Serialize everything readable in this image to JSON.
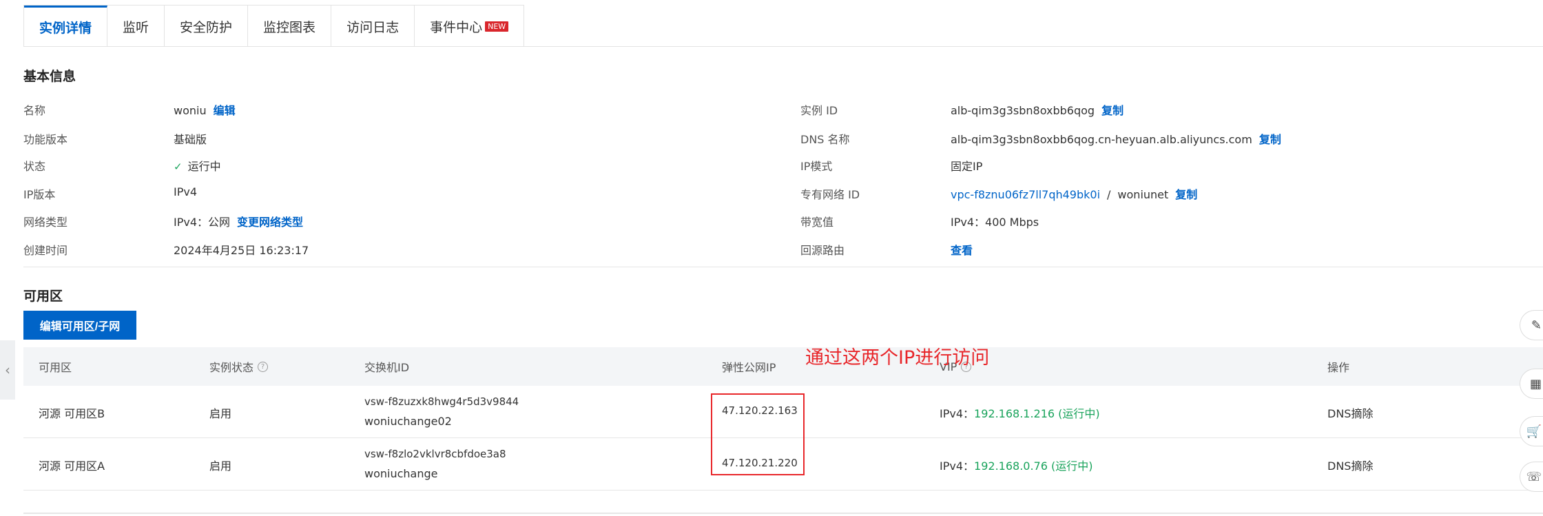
{
  "tabs": [
    {
      "label": "实例详情"
    },
    {
      "label": "监听"
    },
    {
      "label": "安全防护"
    },
    {
      "label": "监控图表"
    },
    {
      "label": "访问日志"
    },
    {
      "label": "事件中心",
      "badge": "NEW"
    }
  ],
  "basic": {
    "title": "基本信息",
    "left": {
      "name_label": "名称",
      "name_value": "woniu",
      "name_action": "编辑",
      "version_label": "功能版本",
      "version_value": "基础版",
      "status_label": "状态",
      "status_value": "运行中",
      "ipver_label": "IP版本",
      "ipver_value": "IPv4",
      "nettype_label": "网络类型",
      "nettype_value": "IPv4：公网",
      "nettype_action": "变更网络类型",
      "created_label": "创建时间",
      "created_value": "2024年4月25日 16:23:17"
    },
    "right": {
      "id_label": "实例 ID",
      "id_value": "alb-qim3g3sbn8oxbb6qog",
      "id_action": "复制",
      "dns_label": "DNS 名称",
      "dns_value": "alb-qim3g3sbn8oxbb6qog.cn-heyuan.alb.aliyuncs.com",
      "dns_action": "复制",
      "ipmode_label": "IP模式",
      "ipmode_value": "固定IP",
      "vpc_label": "专有网络 ID",
      "vpc_value": "vpc-f8znu06fz7ll7qh49bk0i",
      "vpc_sep": "/",
      "vpc_name": "woniunet",
      "vpc_action": "复制",
      "bw_label": "带宽值",
      "bw_value": "IPv4：400 Mbps",
      "route_label": "回源路由",
      "route_action": "查看"
    }
  },
  "zones": {
    "title": "可用区",
    "edit_button": "编辑可用区/子网",
    "headers": [
      "可用区",
      "实例状态",
      "交换机ID",
      "弹性公网IP",
      "VIP",
      "操作"
    ],
    "rows": [
      {
        "zone": "河源 可用区B",
        "state": "启用",
        "vsw_id": "vsw-f8zuzxk8hwg4r5d3v9844",
        "vsw_name": "woniuchange02",
        "eip": "47.120.22.163",
        "vip_prefix": "IPv4：",
        "vip": "192.168.1.216 (运行中)",
        "action": "DNS摘除"
      },
      {
        "zone": "河源 可用区A",
        "state": "启用",
        "vsw_id": "vsw-f8zlo2vklvr8cbfdoe3a8",
        "vsw_name": "woniuchange",
        "eip": "47.120.21.220",
        "vip_prefix": "IPv4：",
        "vip": "192.168.0.76 (运行中)",
        "action": "DNS摘除"
      }
    ]
  },
  "annotation": {
    "text": "通过这两个IP进行访问",
    "color": "#e8262a"
  },
  "colors": {
    "primary": "#0064c8",
    "success": "#19a35b",
    "new_badge": "#d9262c"
  },
  "icons": {
    "help": "question-circle-icon",
    "check": "check-icon",
    "collapse": "chevron-left-icon"
  }
}
